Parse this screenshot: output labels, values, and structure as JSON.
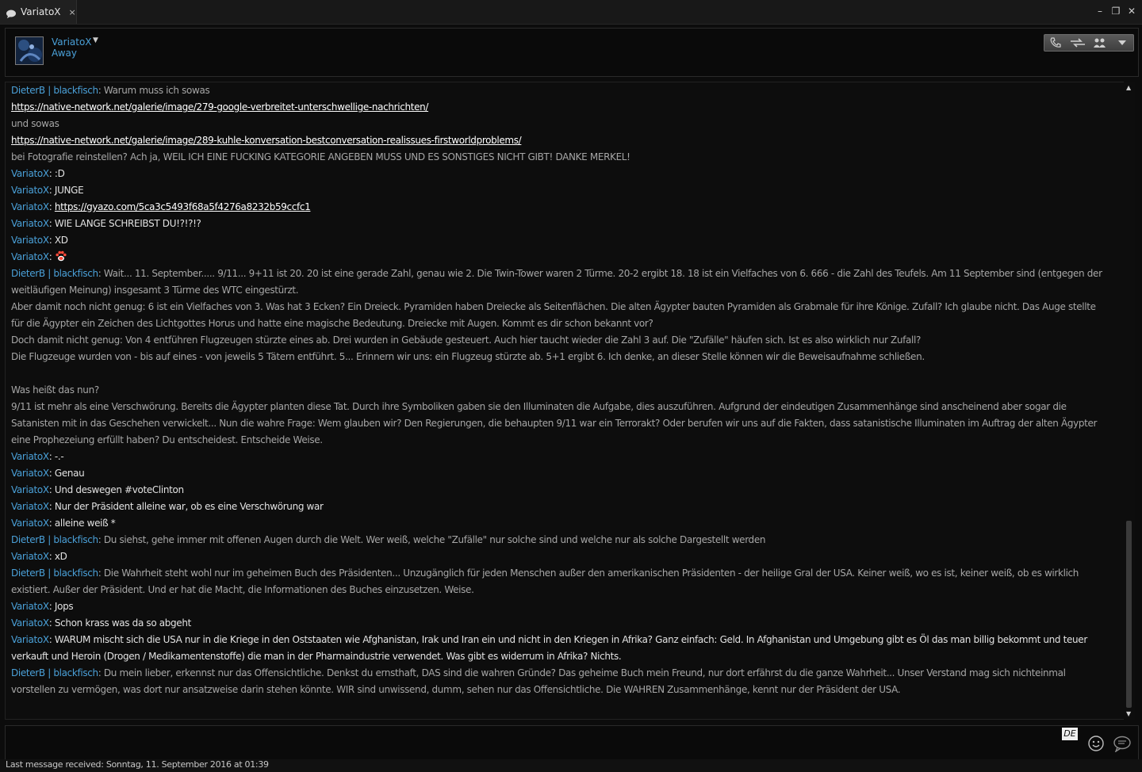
{
  "window": {
    "tab_title": "VariatoX",
    "tab_close": "×",
    "minimize": "–",
    "restore": "❐",
    "close": "✕"
  },
  "contact": {
    "name": "VariatoX",
    "status": "Away",
    "caret": "▼"
  },
  "toolbar": {
    "icons": [
      "phone-icon",
      "file-transfer-icon",
      "add-participants-icon",
      "more-dropdown-icon"
    ]
  },
  "messages": [
    {
      "sender": "DieterB | blackfisch",
      "text": "Warum muss ich sowas"
    },
    {
      "link": "https://native-network.net/galerie/image/279-google-verbreitet-unterschwellige-nachrichten/"
    },
    {
      "cont": "und sowas"
    },
    {
      "link": "https://native-network.net/galerie/image/289-kuhle-konversation-bestconversation-realissues-firstworldproblems/"
    },
    {
      "cont": "bei Fotografie reinstellen? Ach ja, WEIL ICH EINE FUCKING KATEGORIE ANGEBEN MUSS UND ES SONSTIGES NICHT GIBT! DANKE MERKEL!"
    },
    {
      "sender": "VariatoX",
      "text": ":D"
    },
    {
      "sender": "VariatoX",
      "text": "JUNGE"
    },
    {
      "sender": "VariatoX",
      "linktext": "https://gyazo.com/5ca3c5493f68a5f4276a8232b59ccfc1"
    },
    {
      "sender": "VariatoX",
      "text": "WIE LANGE SCHREIBST DU!?!?!?"
    },
    {
      "sender": "VariatoX",
      "text": "XD"
    },
    {
      "sender": "VariatoX",
      "emoticon": "paw-emoticon"
    },
    {
      "sender": "DieterB | blackfisch",
      "text": "Wait... 11. September..... 9/11... 9+11 ist 20. 20 ist eine gerade Zahl, genau wie 2. Die Twin-Tower waren 2 Türme. 20-2 ergibt 18. 18 ist ein Vielfaches von 6. 666 - die Zahl des Teufels. Am 11 September sind (entgegen der weitläufigen Meinung) insgesamt 3 Türme des WTC eingestürzt."
    },
    {
      "cont": "Aber damit noch nicht genug: 6 ist ein Vielfaches von 3. Was hat 3 Ecken? Ein Dreieck. Pyramiden haben Dreiecke als Seitenflächen. Die alten Ägypter bauten Pyramiden als Grabmale für ihre Könige. Zufall? Ich glaube nicht. Das Auge stellte für die Ägypter ein Zeichen des Lichtgottes Horus und hatte eine magische Bedeutung. Dreiecke mit Augen. Kommt es dir schon bekannt vor?"
    },
    {
      "cont": "Doch damit nicht genug: Von 4 entführen Flugzeugen stürzte eines ab. Drei wurden in Gebäude gesteuert. Auch hier taucht wieder die Zahl 3 auf. Die \"Zufälle\" häufen sich. Ist es also wirklich nur Zufall?"
    },
    {
      "cont": "Die Flugzeuge wurden von - bis auf eines - von jeweils 5 Tätern entführt. 5... Erinnern wir uns: ein Flugzeug stürzte ab. 5+1 ergibt 6. Ich denke, an dieser Stelle können wir die Beweisaufnahme schließen."
    },
    {
      "blank": true
    },
    {
      "cont": "Was heißt das nun?"
    },
    {
      "cont": "9/11 ist mehr als eine Verschwörung.  Bereits die Ägypter planten diese Tat. Durch ihre Symboliken gaben sie den Illuminaten die Aufgabe, dies auszuführen. Aufgrund der eindeutigen Zusammenhänge sind anscheinend aber sogar die Satanisten mit in das Geschehen verwickelt... Nun die wahre Frage: Wem glauben wir? Den Regierungen, die behaupten 9/11 war ein Terrorakt? Oder berufen wir uns auf die Fakten, dass satanistische Illuminaten im Auftrag der alten Ägypter eine Prophezeiung erfüllt haben? Du entscheidest. Entscheide Weise."
    },
    {
      "sender": "VariatoX",
      "text": "-.-"
    },
    {
      "sender": "VariatoX",
      "text": "Genau"
    },
    {
      "sender": "VariatoX",
      "text": "Und deswegen #voteClinton"
    },
    {
      "sender": "VariatoX",
      "text": "Nur der Präsident alleine war, ob es eine Verschwörung war"
    },
    {
      "sender": "VariatoX",
      "text": "alleine weiß *"
    },
    {
      "sender": "DieterB | blackfisch",
      "text": "Du siehst, gehe immer mit offenen Augen durch die Welt. Wer weiß, welche \"Zufälle\" nur solche sind und welche nur als solche Dargestellt werden"
    },
    {
      "sender": "VariatoX",
      "text": "xD"
    },
    {
      "sender": "DieterB | blackfisch",
      "text": "Die Wahrheit steht wohl nur im geheimen Buch des Präsidenten... Unzugänglich für jeden Menschen außer den amerikanischen Präsidenten - der heilige Gral der USA. Keiner weiß, wo es ist, keiner weiß, ob es wirklich existiert. Außer der Präsident. Und er hat die Macht, die Informationen des Buches einzusetzen. Weise."
    },
    {
      "sender": "VariatoX",
      "text": "Jops"
    },
    {
      "sender": "VariatoX",
      "text": "Schon krass was da so abgeht"
    },
    {
      "sender": "VariatoX",
      "text": "WARUM mischt sich die USA nur in die Kriege in den Oststaaten wie Afghanistan, Irak und Iran ein und nicht in den Kriegen in Afrika? Ganz einfach: Geld. In Afghanistan und Umgebung gibt es Öl das man billig bekommt und teuer verkauft und Heroin (Drogen / Medikamentenstoffe) die man in der Pharmaindustrie verwendet. Was gibt es widerrum in Afrika? Nichts."
    },
    {
      "sender": "DieterB | blackfisch",
      "text": "Du mein lieber, erkennst nur das Offensichtliche. Denkst du ernsthaft, DAS sind die wahren Gründe? Das geheime Buch mein Freund, nur dort erfährst du die ganze Wahrheit... Unser Verstand mag sich nichteinmal vorstellen zu vermögen, was dort nur ansatzweise darin stehen könnte. WIR sind unwissend, dumm, sehen nur das Offensichtliche. Die WAHREN Zusammenhänge, kennt nur der Präsident der USA."
    }
  ],
  "input": {
    "language": "DE",
    "placeholder": ""
  },
  "scrollbar": {
    "up": "▲",
    "down": "▼"
  },
  "status": {
    "last_message": "Last message received: Sonntag, 11. September 2016 at 01:39"
  },
  "colors": {
    "accent": "#4aa0d8",
    "background": "#0c0c0c",
    "text_dim": "#a6a6a6",
    "text_bright": "#e2e2e2"
  }
}
